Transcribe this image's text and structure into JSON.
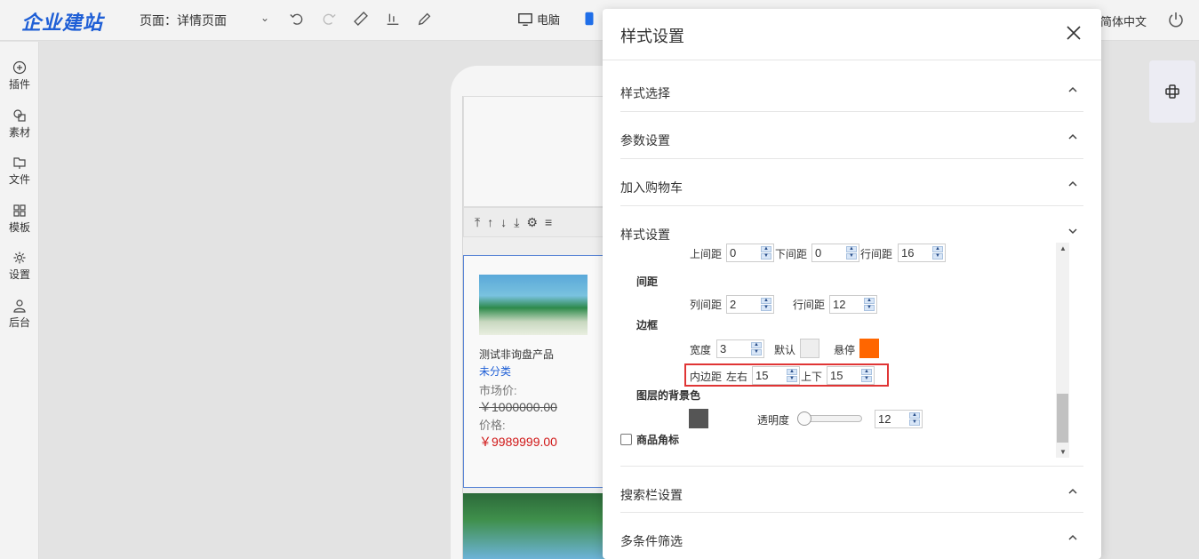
{
  "topbar": {
    "logo": "企业建站",
    "page_label": "页面：详情页面",
    "device_pc": "电脑",
    "lang": "简体中文"
  },
  "sidebar": {
    "items": [
      {
        "label": "插件",
        "icon": "plus-circle-icon"
      },
      {
        "label": "素材",
        "icon": "shapes-icon"
      },
      {
        "label": "文件",
        "icon": "folder-icon"
      },
      {
        "label": "模板",
        "icon": "grid-icon"
      },
      {
        "label": "设置",
        "icon": "gear-icon"
      },
      {
        "label": "后台",
        "icon": "user-icon"
      }
    ]
  },
  "product": {
    "name": "测试非询盘产品",
    "category": "未分类",
    "market_label": "市场价:",
    "market_price": "￥1000000.00",
    "price_label": "价格:",
    "price": "￥9989999.00"
  },
  "dialog": {
    "title": "样式设置",
    "sections": {
      "style_select": "样式选择",
      "params": "参数设置",
      "cart": "加入购物车",
      "style_settings": "样式设置",
      "search_bar": "搜索栏设置",
      "filter": "多条件筛选"
    },
    "fields": {
      "top_margin_label": "上间距",
      "top_margin": "0",
      "bottom_margin_label": "下间距",
      "bottom_margin": "0",
      "line_gap_label": "行间距",
      "line_gap": "16",
      "spacing_heading": "间距",
      "col_gap_label": "列间距",
      "col_gap": "2",
      "row_gap_label": "行间距",
      "row_gap": "12",
      "border_heading": "边框",
      "width_label": "宽度",
      "width": "3",
      "default_label": "默认",
      "hover_label": "悬停",
      "padding_label": "内边距",
      "lr_label": "左右",
      "lr_value": "15",
      "tb_label": "上下",
      "tb_value": "15",
      "layer_bg_heading": "图层的背景色",
      "opacity_label": "透明度",
      "opacity_value": "12",
      "badge_label": "商品角标"
    },
    "colors": {
      "default_border": "#eeeeee",
      "hover_border": "#ff6600",
      "layer_bg": "#555555"
    }
  }
}
